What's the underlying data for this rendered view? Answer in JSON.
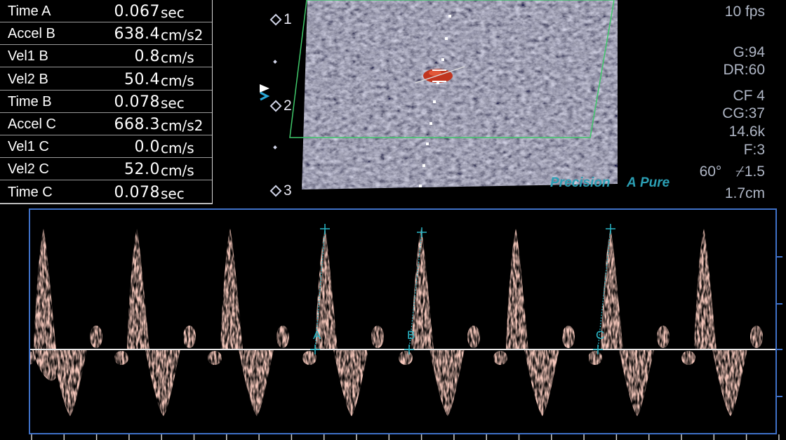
{
  "measurements": [
    {
      "label": "Time A",
      "value": "0.067",
      "unit": "sec"
    },
    {
      "label": "Accel B",
      "value": "638.4",
      "unit": "cm/s2"
    },
    {
      "label": "Vel1 B",
      "value": "0.8",
      "unit": "cm/s"
    },
    {
      "label": "Vel2 B",
      "value": "50.4",
      "unit": "cm/s"
    },
    {
      "label": "Time B",
      "value": "0.078",
      "unit": "sec"
    },
    {
      "label": "Accel C",
      "value": "668.3",
      "unit": "cm/s2"
    },
    {
      "label": "Vel1 C",
      "value": "0.0",
      "unit": "cm/s"
    },
    {
      "label": "Vel2 C",
      "value": "52.0",
      "unit": "cm/s"
    },
    {
      "label": "Time C",
      "value": "0.078",
      "unit": "sec"
    }
  ],
  "params": {
    "fps": "10 fps",
    "gain": "G:94",
    "dynamic_range": "DR:60",
    "cf": "CF 4",
    "cg": "CG:37",
    "freq": "14.6k",
    "filter": "F:3",
    "angle": "60°",
    "angle_value": "1.5",
    "gate": "1.7cm"
  },
  "depth_markers": [
    "1",
    "2",
    "3"
  ],
  "branding": {
    "precision": "Precision",
    "pure_a": "A",
    "pure": "Pure"
  },
  "markers": [
    "A",
    "B",
    "C"
  ],
  "colors": {
    "param_text": "#aeb5c4",
    "roi_box": "#3fc86a",
    "spectral_trace": "#e8907e",
    "caliper": "#29b6c6",
    "panel_border": "#3f71c8",
    "brand": "#2b9fb4"
  }
}
